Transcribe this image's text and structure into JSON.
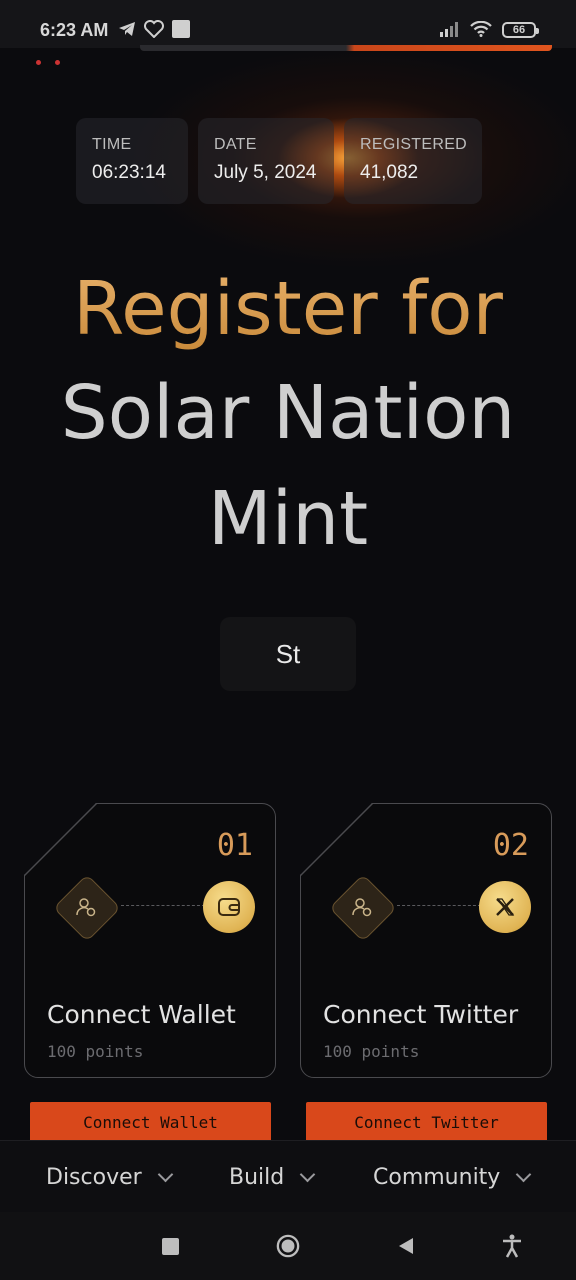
{
  "status_bar": {
    "time": "6:23 AM",
    "battery": "66"
  },
  "stats": [
    {
      "label": "TIME",
      "value": "06:23:14"
    },
    {
      "label": "DATE",
      "value": "July 5, 2024"
    },
    {
      "label": "REGISTERED",
      "value": "41,082"
    }
  ],
  "heading": {
    "line1": "Register for",
    "line2": "Solar Nation",
    "line3": "Mint"
  },
  "countdown_box": "St",
  "cards": [
    {
      "number": "01",
      "title": "Connect Wallet",
      "points": "100 points",
      "button": "Connect Wallet"
    },
    {
      "number": "02",
      "title": "Connect Twitter",
      "points": "100 points",
      "button": "Connect Twitter"
    }
  ],
  "bottom_nav": [
    {
      "label": "Discover"
    },
    {
      "label": "Build"
    },
    {
      "label": "Community"
    }
  ],
  "colors": {
    "accent": "#d9481b",
    "gold": "#d9984a",
    "background": "#0b0b0e"
  }
}
